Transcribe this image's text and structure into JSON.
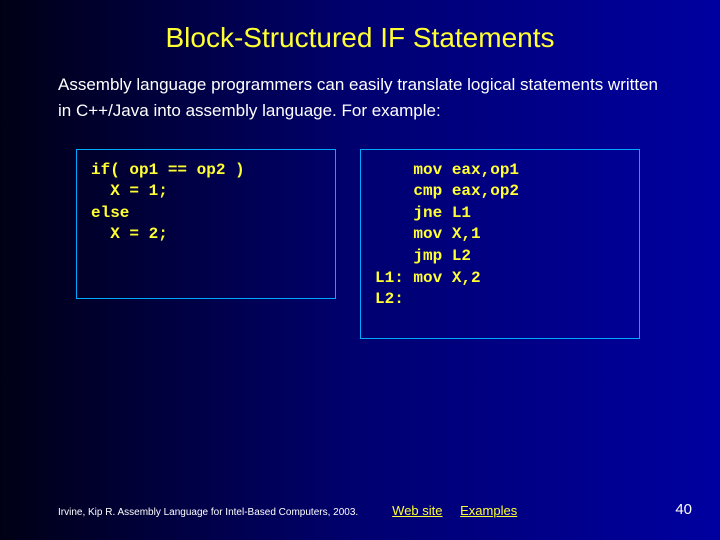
{
  "title": "Block-Structured IF Statements",
  "body": "Assembly language programmers can easily translate logical statements written in C++/Java into assembly language. For example:",
  "code_left": "if( op1 == op2 )\n  X = 1;\nelse\n  X = 2;",
  "code_right": "    mov eax,op1\n    cmp eax,op2\n    jne L1\n    mov X,1\n    jmp L2\nL1: mov X,2\nL2:",
  "footer": {
    "credit": "Irvine, Kip R. Assembly Language for Intel-Based Computers, 2003.",
    "link1": "Web site",
    "link2": "Examples",
    "page": "40"
  }
}
